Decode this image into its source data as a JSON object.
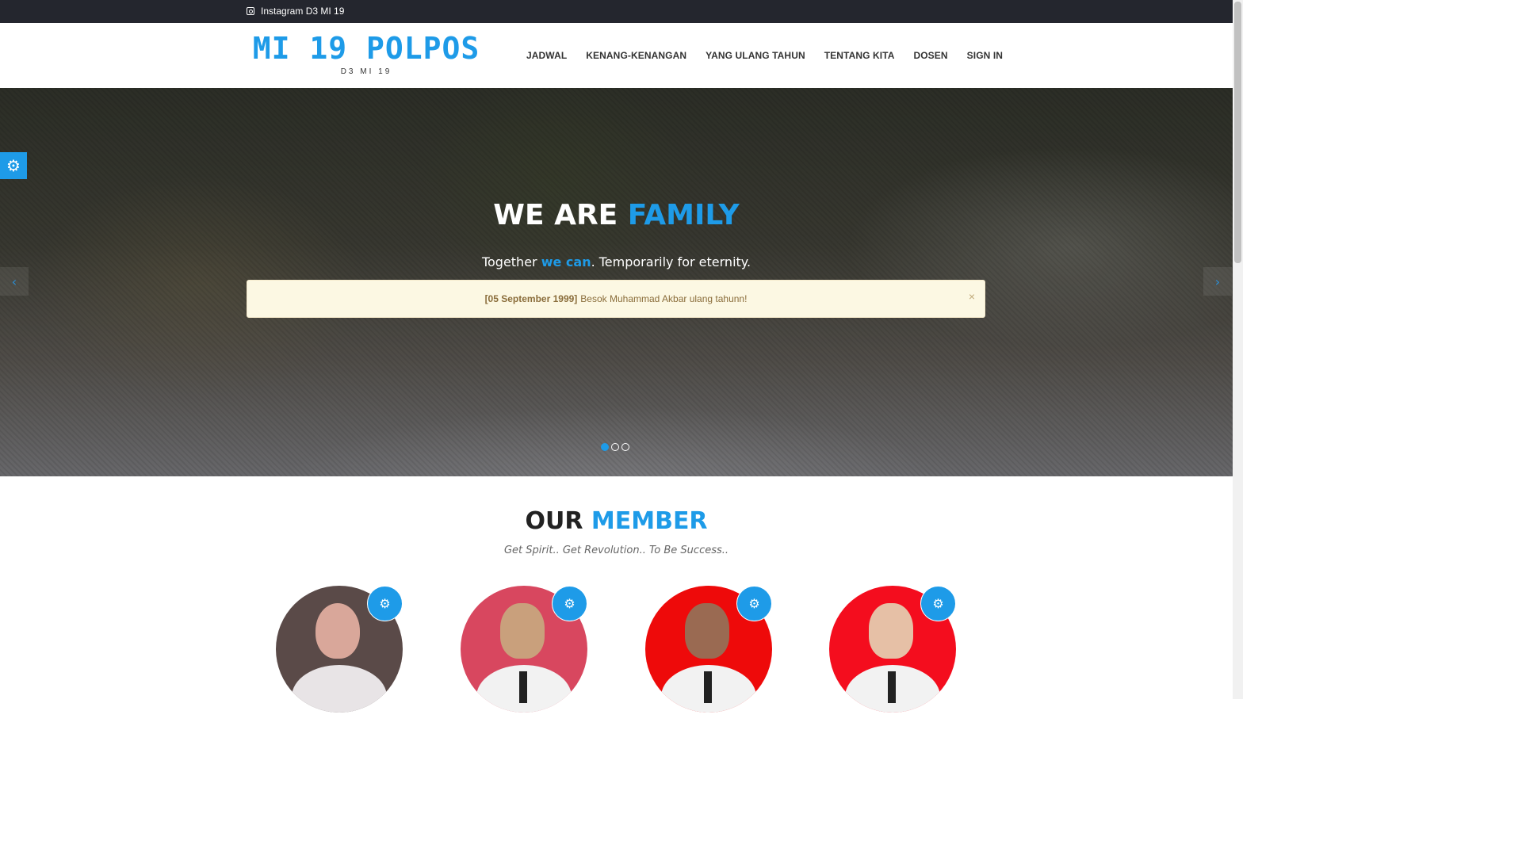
{
  "topbar": {
    "instagram_label": "Instagram D3 MI 19"
  },
  "header": {
    "logo_title": "MI 19 POLPOS",
    "logo_subtitle": "D3 MI 19",
    "nav": [
      "JADWAL",
      "KENANG-KENANGAN",
      "YANG ULANG TAHUN",
      "TENTANG KITA",
      "DOSEN",
      "SIGN IN"
    ]
  },
  "hero": {
    "title_part1": "WE ARE ",
    "title_part2": "FAMILY",
    "subtitle_part1": "Together ",
    "subtitle_part2": "we can",
    "subtitle_part3": ". Temporarily for eternity.",
    "alert_date": "[05 September 1999]",
    "alert_text": "Besok Muhammad Akbar ulang tahunn!",
    "alert_close": "×",
    "arrow_left": "‹",
    "arrow_right": "›",
    "slide_count": 3,
    "active_slide": 1
  },
  "members_section": {
    "title_part1": "OUR ",
    "title_part2": "MEMBER",
    "subtitle": "Get Spirit.. Get Revolution.. To Be Success.."
  },
  "members": [
    {
      "avatar_bg": "#5a4a48",
      "clothing": "hijab"
    },
    {
      "avatar_bg": "#d8475f",
      "clothing": "shirt"
    },
    {
      "avatar_bg": "#ee0a0a",
      "clothing": "shirt"
    },
    {
      "avatar_bg": "#f40d1e",
      "clothing": "shirt"
    }
  ],
  "colors": {
    "accent": "#1e9be8",
    "topbar": "#24262e",
    "alert_bg": "#fcf8e3",
    "alert_text": "#8a6d3b"
  },
  "icons": {
    "settings": "gear-icon",
    "instagram": "instagram-icon"
  }
}
